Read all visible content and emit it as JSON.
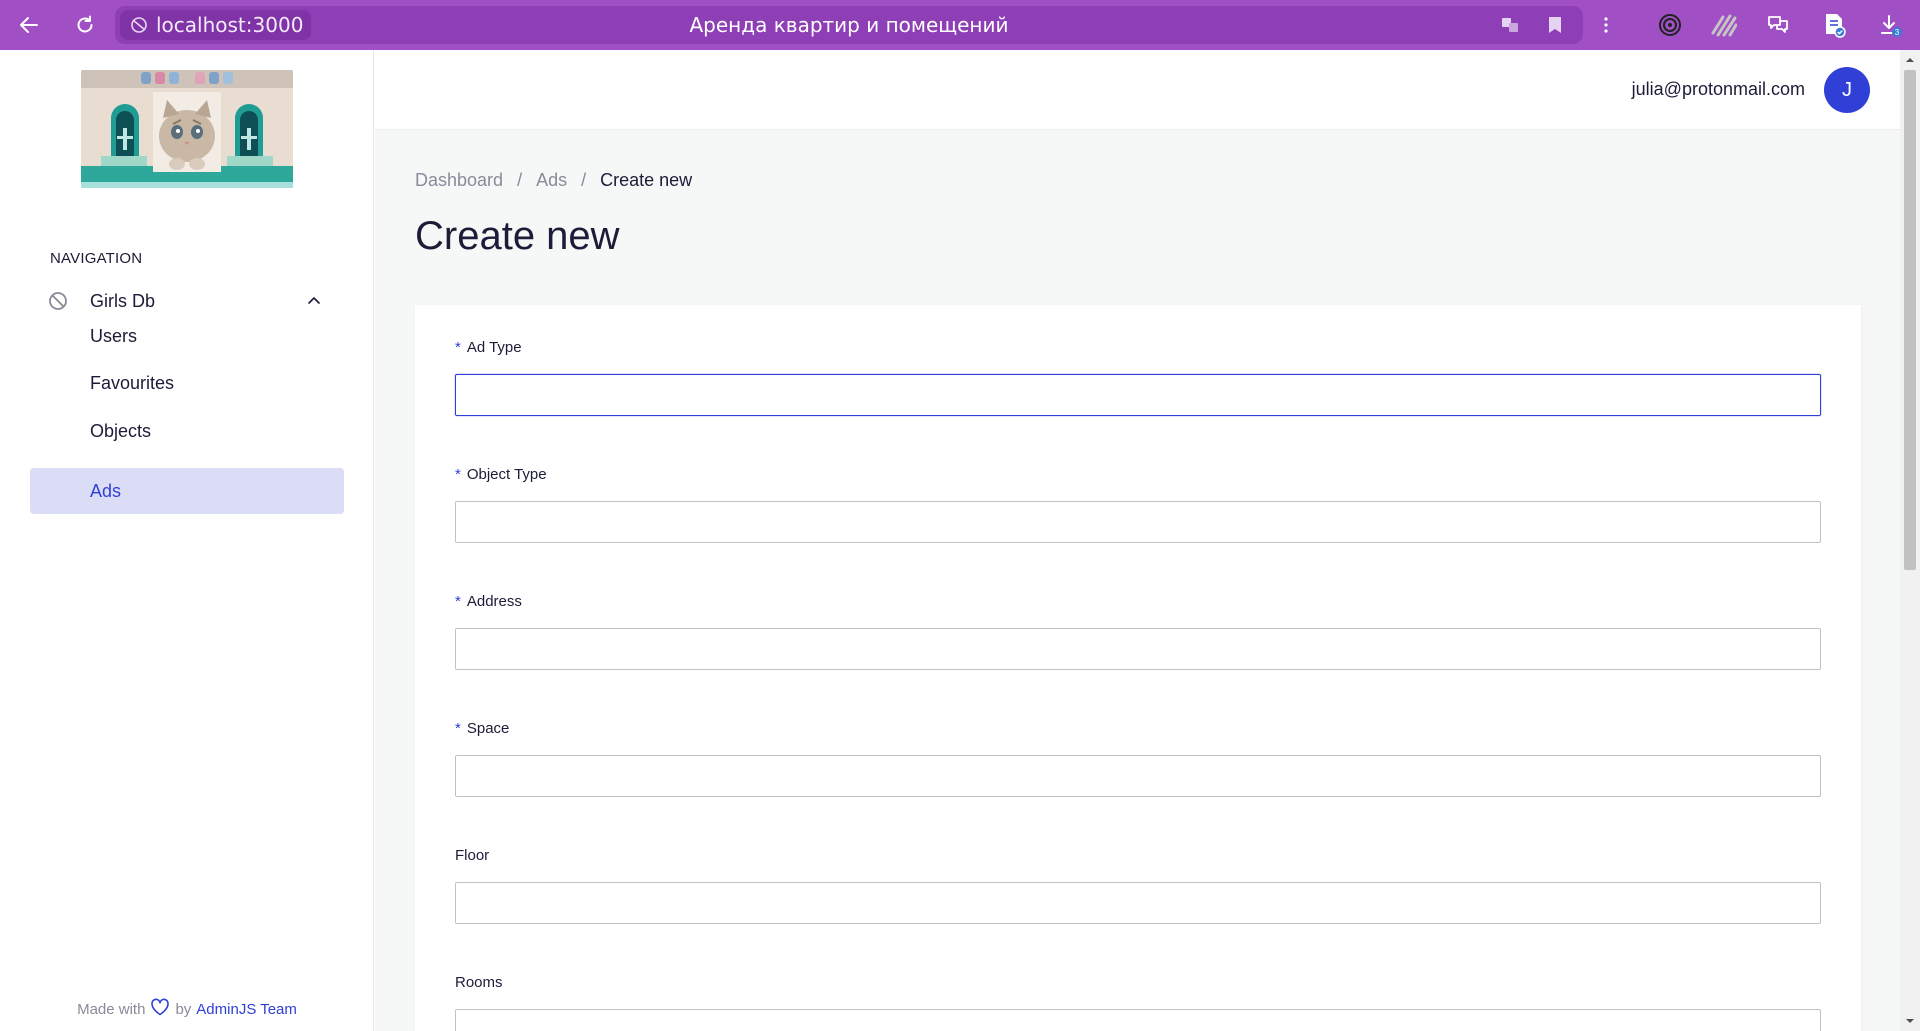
{
  "browser": {
    "url": "localhost:3000",
    "tab_title": "Аренда квартир и помещений",
    "downloads_badge": "3"
  },
  "sidebar": {
    "navigation_heading": "NAVIGATION",
    "group": {
      "label": "Girls Db",
      "icon": "ban-icon"
    },
    "items": [
      {
        "label": "Users",
        "active": false
      },
      {
        "label": "Favourites",
        "active": false
      },
      {
        "label": "Objects",
        "active": false
      },
      {
        "label": "Ads",
        "active": true
      }
    ],
    "footer": {
      "made_with": "Made with",
      "by": "by",
      "team": "AdminJS Team"
    }
  },
  "header": {
    "user_email": "julia@protonmail.com",
    "avatar_initial": "J"
  },
  "breadcrumb": {
    "items": [
      "Dashboard",
      "Ads",
      "Create new"
    ],
    "separator": "/"
  },
  "page": {
    "title": "Create new"
  },
  "form": {
    "fields": [
      {
        "label": "Ad Type",
        "required": true,
        "value": "",
        "focused": true
      },
      {
        "label": "Object Type",
        "required": true,
        "value": ""
      },
      {
        "label": "Address",
        "required": true,
        "value": ""
      },
      {
        "label": "Space",
        "required": true,
        "value": ""
      },
      {
        "label": "Floor",
        "required": false,
        "value": ""
      },
      {
        "label": "Rooms",
        "required": false,
        "value": ""
      }
    ],
    "required_marker": "*"
  },
  "colors": {
    "browser_bar": "#a04fc4",
    "primary": "#3040d6",
    "active_nav_bg": "#dbdcf5"
  }
}
